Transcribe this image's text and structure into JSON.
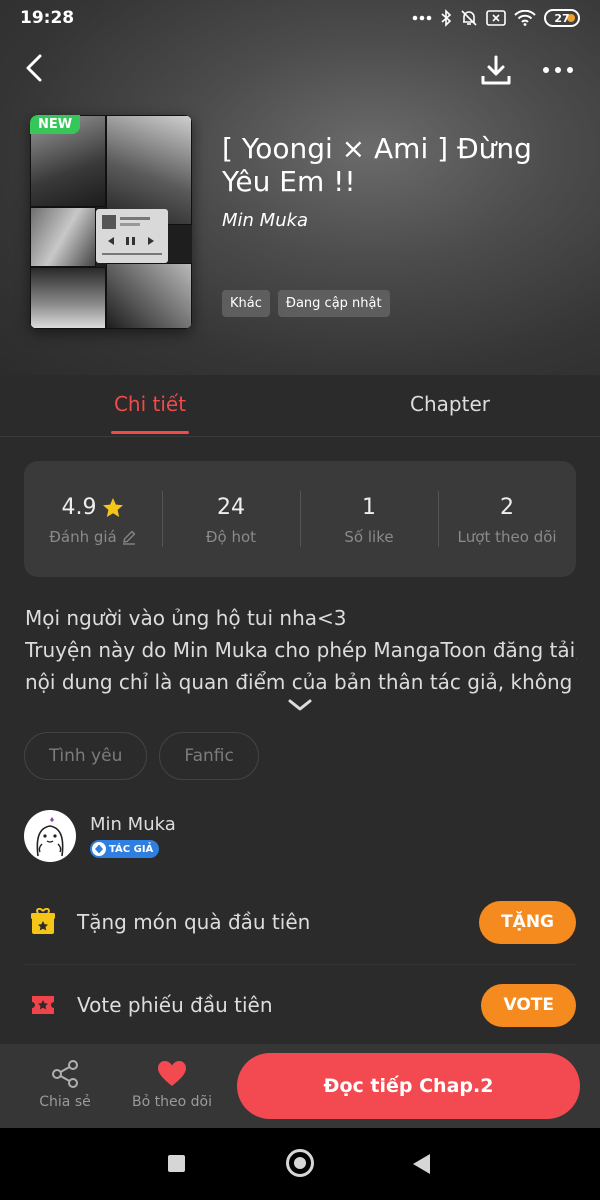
{
  "status_bar": {
    "time": "19:28",
    "battery": "27",
    "icons": [
      "more-dots-icon",
      "bluetooth-icon",
      "mute-icon",
      "sim-off-icon",
      "wifi-icon",
      "battery-icon"
    ]
  },
  "header": {
    "back_icon": "back-arrow-icon",
    "download_icon": "download-icon",
    "more_icon": "more-icon"
  },
  "comic": {
    "badge": "NEW",
    "title": "[ Yoongi × Ami ] Đừng Yêu Em !!",
    "author": "Min Muka",
    "tags": [
      "Khác",
      "Đang cập nhật"
    ]
  },
  "tabs": [
    {
      "label": "Chi tiết",
      "active": true
    },
    {
      "label": "Chapter",
      "active": false
    }
  ],
  "stats": [
    {
      "value": "4.9",
      "label": "Đánh giá",
      "icon": "star-icon",
      "label_icon": "edit-icon"
    },
    {
      "value": "24",
      "label": "Độ hot"
    },
    {
      "value": "1",
      "label": "Số like"
    },
    {
      "value": "2",
      "label": "Lượt theo dõi"
    }
  ],
  "description": [
    "Mọi người vào ủng hộ tui nha<3",
    "Truyện này do Min Muka cho phép MangaToon đăng tải,",
    "nội dung chỉ là quan điểm của bản thân tác giả, không"
  ],
  "genres": [
    "Tình yêu",
    "Fanfic"
  ],
  "author_row": {
    "name": "Min Muka",
    "badge": "TÁC GIẢ"
  },
  "gift": {
    "text": "Tặng món quà đầu tiên",
    "button": "TẶNG"
  },
  "vote": {
    "text": "Vote phiếu đầu tiên",
    "button": "VOTE"
  },
  "bottom_bar": {
    "share_label": "Chia sẻ",
    "unfollow_label": "Bỏ theo dõi",
    "read_button": "Đọc tiếp Chap.2"
  },
  "colors": {
    "accent_red": "#f24a50",
    "tab_active": "#f04a4a",
    "button_orange": "#f58a1f",
    "new_badge": "#35c759",
    "star": "#f5c518",
    "author_badge": "#2f7fe0"
  }
}
